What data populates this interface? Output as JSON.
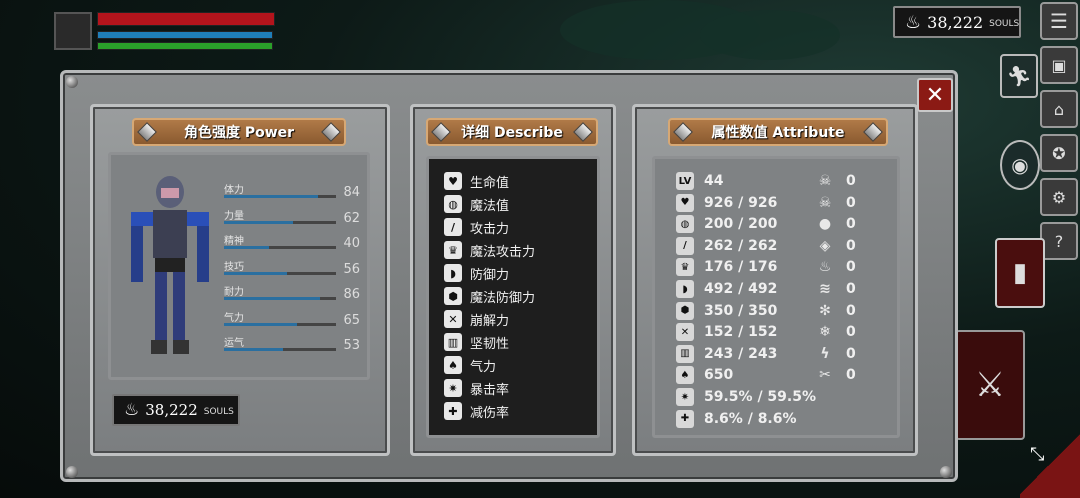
{
  "hud": {
    "souls_value": "38,222",
    "souls_label": "SOULS"
  },
  "panels": {
    "power": {
      "title": "角色强度 Power",
      "stats": [
        {
          "name": "体力",
          "value": "84",
          "fill": 0.84
        },
        {
          "name": "力量",
          "value": "62",
          "fill": 0.62
        },
        {
          "name": "精神",
          "value": "40",
          "fill": 0.4
        },
        {
          "name": "技巧",
          "value": "56",
          "fill": 0.56
        },
        {
          "name": "耐力",
          "value": "86",
          "fill": 0.86
        },
        {
          "name": "气力",
          "value": "65",
          "fill": 0.65
        },
        {
          "name": "运气",
          "value": "53",
          "fill": 0.53
        }
      ],
      "souls_value": "38,222",
      "souls_label": "SOULS"
    },
    "describe": {
      "title": "详细 Describe",
      "items": [
        {
          "icon": "heart-icon",
          "glyph": "♥",
          "label": "生命值"
        },
        {
          "icon": "mana-icon",
          "glyph": "◍",
          "label": "魔法值"
        },
        {
          "icon": "sword-icon",
          "glyph": "/",
          "label": "攻击力"
        },
        {
          "icon": "magic-attack-icon",
          "glyph": "♛",
          "label": "魔法攻击力"
        },
        {
          "icon": "shield-icon",
          "glyph": "◗",
          "label": "防御力"
        },
        {
          "icon": "magic-shield-icon",
          "glyph": "⬢",
          "label": "魔法防御力"
        },
        {
          "icon": "break-icon",
          "glyph": "✕",
          "label": "崩解力"
        },
        {
          "icon": "toughness-icon",
          "glyph": "▥",
          "label": "坚韧性"
        },
        {
          "icon": "lungs-icon",
          "glyph": "♠",
          "label": "气力"
        },
        {
          "icon": "crit-icon",
          "glyph": "✷",
          "label": "暴击率"
        },
        {
          "icon": "damage-reduction-icon",
          "glyph": "✚",
          "label": "减伤率"
        }
      ]
    },
    "attribute": {
      "title": "属性数值 Attribute",
      "left": [
        {
          "icon": "level-icon",
          "glyph": "LV",
          "value": "44"
        },
        {
          "icon": "heart-icon",
          "glyph": "♥",
          "value": "926 / 926"
        },
        {
          "icon": "mana-icon",
          "glyph": "◍",
          "value": "200 / 200"
        },
        {
          "icon": "sword-icon",
          "glyph": "/",
          "value": "262 / 262"
        },
        {
          "icon": "magic-attack-icon",
          "glyph": "♛",
          "value": "176 / 176"
        },
        {
          "icon": "shield-icon",
          "glyph": "◗",
          "value": "492 / 492"
        },
        {
          "icon": "magic-shield-icon",
          "glyph": "⬢",
          "value": "350 / 350"
        },
        {
          "icon": "break-icon",
          "glyph": "✕",
          "value": "152 / 152"
        },
        {
          "icon": "toughness-icon",
          "glyph": "▥",
          "value": "243 / 243"
        },
        {
          "icon": "lungs-icon",
          "glyph": "♠",
          "value": "650"
        },
        {
          "icon": "crit-icon",
          "glyph": "✷",
          "value": "59.5% / 59.5%"
        },
        {
          "icon": "damage-reduction-icon",
          "glyph": "✚",
          "value": "8.6% / 8.6%"
        }
      ],
      "right": [
        {
          "icon": "skull-icon",
          "glyph": "☠",
          "value": "0"
        },
        {
          "icon": "poison-icon",
          "glyph": "☠",
          "value": "0"
        },
        {
          "icon": "drop-icon",
          "glyph": "●",
          "value": "0"
        },
        {
          "icon": "bleed-icon",
          "glyph": "◈",
          "value": "0"
        },
        {
          "icon": "fire-icon",
          "glyph": "♨",
          "value": "0"
        },
        {
          "icon": "wind-icon",
          "glyph": "≋",
          "value": "0"
        },
        {
          "icon": "frost-icon",
          "glyph": "✻",
          "value": "0"
        },
        {
          "icon": "ice-icon",
          "glyph": "❄",
          "value": "0"
        },
        {
          "icon": "lightning-icon",
          "glyph": "ϟ",
          "value": "0"
        },
        {
          "icon": "curse-icon",
          "glyph": "✂",
          "value": "0"
        }
      ]
    }
  }
}
